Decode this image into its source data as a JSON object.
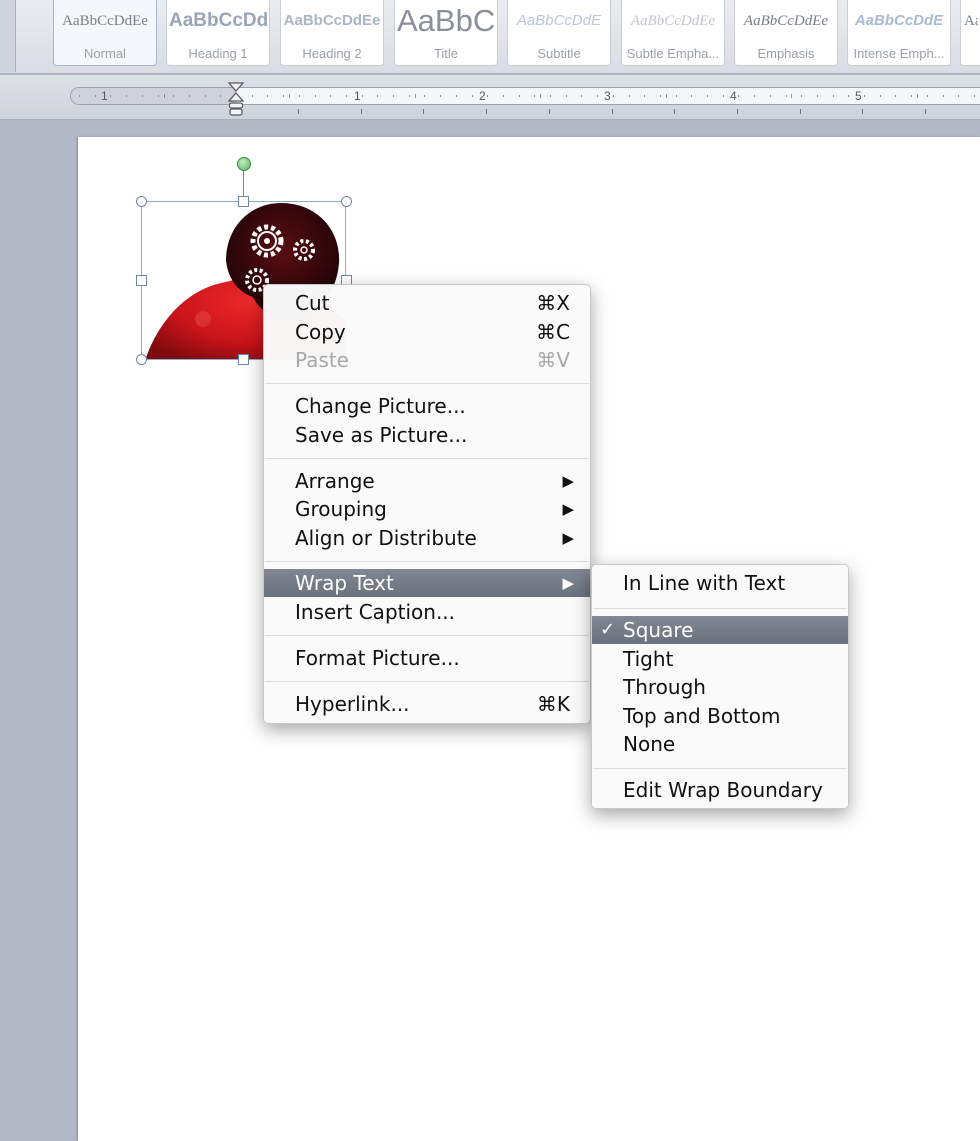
{
  "styles_gallery": {
    "tiles": [
      {
        "sample": "AaBbCcDdEe",
        "name": "Normal"
      },
      {
        "sample": "AaBbCcDd",
        "name": "Heading 1"
      },
      {
        "sample": "AaBbCcDdEe",
        "name": "Heading 2"
      },
      {
        "sample": "AaBbC",
        "name": "Title"
      },
      {
        "sample": "AaBbCcDdE",
        "name": "Subtitle"
      },
      {
        "sample": "AaBbCcDdEe",
        "name": "Subtle Empha..."
      },
      {
        "sample": "AaBbCcDdEe",
        "name": "Emphasis"
      },
      {
        "sample": "AaBbCcDdE",
        "name": "Intense Emph..."
      },
      {
        "sample": "Aa",
        "name": ""
      }
    ]
  },
  "ruler": {
    "labels": [
      "1",
      "1",
      "2",
      "3",
      "4",
      "5"
    ]
  },
  "context_menu": {
    "cut": {
      "label": "Cut",
      "shortcut": "⌘X"
    },
    "copy": {
      "label": "Copy",
      "shortcut": "⌘C"
    },
    "paste": {
      "label": "Paste",
      "shortcut": "⌘V"
    },
    "change_picture": {
      "label": "Change Picture..."
    },
    "save_as_picture": {
      "label": "Save as Picture..."
    },
    "arrange": {
      "label": "Arrange",
      "arrow": "▶"
    },
    "grouping": {
      "label": "Grouping",
      "arrow": "▶"
    },
    "align_distribute": {
      "label": "Align or Distribute",
      "arrow": "▶"
    },
    "wrap_text": {
      "label": "Wrap Text",
      "arrow": "▶"
    },
    "insert_caption": {
      "label": "Insert Caption..."
    },
    "format_picture": {
      "label": "Format Picture..."
    },
    "hyperlink": {
      "label": "Hyperlink...",
      "shortcut": "⌘K"
    }
  },
  "wrap_submenu": {
    "in_line": {
      "label": "In Line with Text"
    },
    "square": {
      "label": "Square",
      "check": "✓"
    },
    "tight": {
      "label": "Tight"
    },
    "through": {
      "label": "Through"
    },
    "top_bottom": {
      "label": "Top and Bottom"
    },
    "none": {
      "label": "None"
    },
    "edit_boundary": {
      "label": "Edit Wrap Boundary"
    }
  },
  "colors": {
    "highlight": "#717985",
    "picture_red": "#c8141a",
    "selection_border": "#8aa9cf"
  }
}
